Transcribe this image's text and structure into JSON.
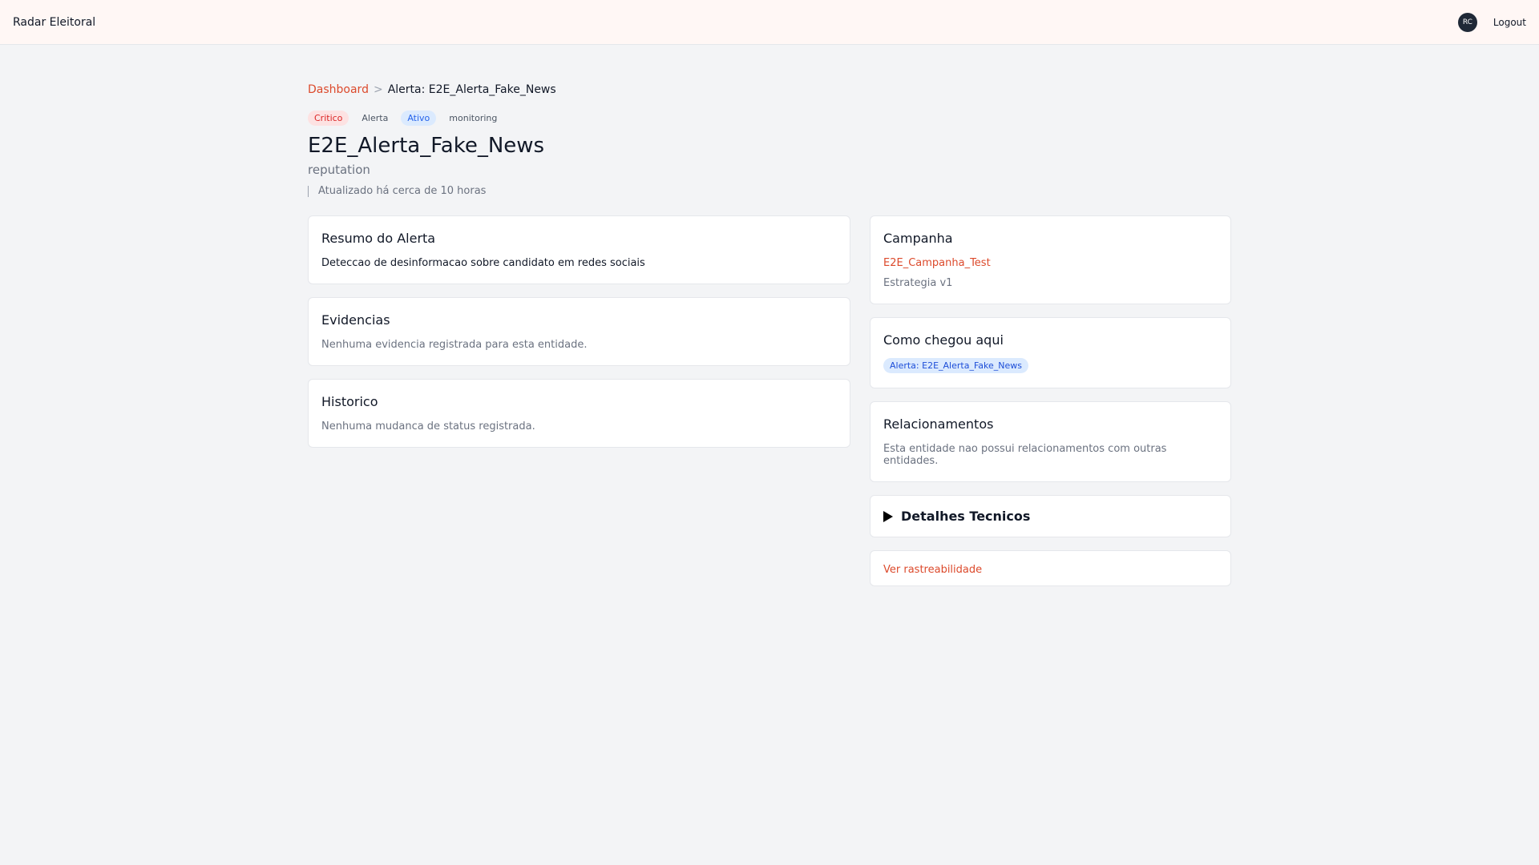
{
  "header": {
    "brand": "Radar Eleitoral",
    "avatar_initials": "RC",
    "logout_label": "Logout"
  },
  "breadcrumb": {
    "root": "Dashboard",
    "separator": ">",
    "current": "Alerta: E2E_Alerta_Fake_News"
  },
  "tags": {
    "severity": "Critico",
    "type": "Alerta",
    "status": "Ativo",
    "stage": "monitoring"
  },
  "entity": {
    "title": "E2E_Alerta_Fake_News",
    "category": "reputation",
    "updated": "Atualizado há cerca de 10 horas"
  },
  "summary": {
    "title": "Resumo do Alerta",
    "text": "Deteccao de desinformacao sobre candidato em redes sociais"
  },
  "evidence": {
    "title": "Evidencias",
    "empty": "Nenhuma evidencia registrada para esta entidade."
  },
  "history": {
    "title": "Historico",
    "empty": "Nenhuma mudanca de status registrada."
  },
  "campaign": {
    "title": "Campanha",
    "name": "E2E_Campanha_Test",
    "strategy": "Estrategia v1"
  },
  "origin": {
    "title": "Como chegou aqui",
    "chip": "Alerta: E2E_Alerta_Fake_News"
  },
  "relations": {
    "title": "Relacionamentos",
    "empty": "Esta entidade nao possui relacionamentos com outras entidades."
  },
  "details": {
    "label": "Detalhes Tecnicos"
  },
  "trace": {
    "label": "Ver rastreabilidade"
  },
  "colors": {
    "accent": "#dc4a2c",
    "critical_bg": "#fde2e2",
    "active_bg": "#dbeafe"
  }
}
